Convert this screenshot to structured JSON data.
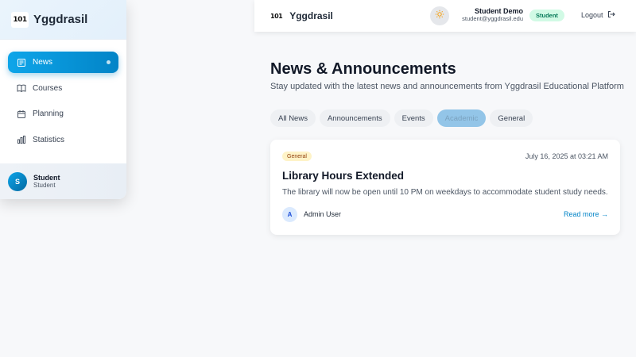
{
  "sidebar": {
    "logo_text": "101",
    "brand": "Yggdrasil",
    "items": [
      {
        "label": "News",
        "icon": "newspaper-icon",
        "active": true
      },
      {
        "label": "Courses",
        "icon": "book-icon",
        "active": false
      },
      {
        "label": "Planning",
        "icon": "calendar-icon",
        "active": false
      },
      {
        "label": "Statistics",
        "icon": "bar-chart-icon",
        "active": false
      }
    ],
    "user": {
      "initial": "S",
      "name": "Student",
      "role": "Student"
    }
  },
  "topbar": {
    "logo_text": "101",
    "brand": "Yggdrasil",
    "theme_icon": "sun-icon",
    "user_name": "Student Demo",
    "user_email": "student@yggdrasil.edu",
    "role_badge": "Student",
    "logout_label": "Logout"
  },
  "main": {
    "title": "News & Announcements",
    "subtitle": "Stay updated with the latest news and announcements from Yggdrasil Educational Platform",
    "filters": [
      {
        "label": "All News",
        "active": false
      },
      {
        "label": "Announcements",
        "active": false
      },
      {
        "label": "Events",
        "active": false
      },
      {
        "label": "Academic",
        "active": true
      },
      {
        "label": "General",
        "active": false
      }
    ],
    "card": {
      "badge": "General",
      "date": "July 16, 2025 at 03:21 AM",
      "title": "Library Hours Extended",
      "body": "The library will now be open until 10 PM on weekdays to accommodate student study needs.",
      "author_initial": "A",
      "author_name": "Admin User",
      "read_more": "Read more →"
    }
  },
  "colors": {
    "accent": "#0284c7",
    "accent_light": "#0ea5e9",
    "badge_green_bg": "#d1fae5",
    "badge_yellow_bg": "#fef3c7",
    "background": "#f7f8fa"
  }
}
